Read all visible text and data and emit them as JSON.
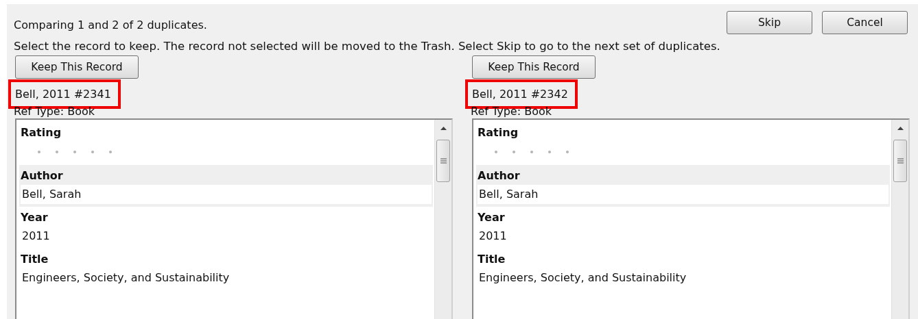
{
  "status": "Comparing 1 and 2 of 2 duplicates.",
  "instructions": "Select the record to keep. The record not selected will be moved to the Trash. Select Skip to go to the next set of duplicates.",
  "buttons": [
    "Skip",
    "Cancel"
  ],
  "records": [
    {
      "keep_button": "Keep This Record",
      "label": "Bell, 2011 #2341",
      "highlighted": true,
      "ref_type": "Ref Type: Book",
      "fields": [
        {
          "kind": "rating",
          "name": "Rating",
          "stars": 0,
          "selected": false
        },
        {
          "kind": "text",
          "name": "Author",
          "value": "Bell, Sarah",
          "selected": true
        },
        {
          "kind": "text",
          "name": "Year",
          "value": "2011",
          "selected": false
        },
        {
          "kind": "text",
          "name": "Title",
          "value": "Engineers, Society, and Sustainability",
          "selected": false
        }
      ]
    },
    {
      "keep_button": "Keep This Record",
      "label": "Bell, 2011 #2342",
      "highlighted": true,
      "ref_type": "Ref Type: Book",
      "fields": [
        {
          "kind": "rating",
          "name": "Rating",
          "stars": 0,
          "selected": false
        },
        {
          "kind": "text",
          "name": "Author",
          "value": "Bell, Sarah",
          "selected": true
        },
        {
          "kind": "text",
          "name": "Year",
          "value": "2011",
          "selected": false
        },
        {
          "kind": "text",
          "name": "Title",
          "value": "Engineers, Society, and Sustainability",
          "selected": false
        }
      ]
    }
  ]
}
